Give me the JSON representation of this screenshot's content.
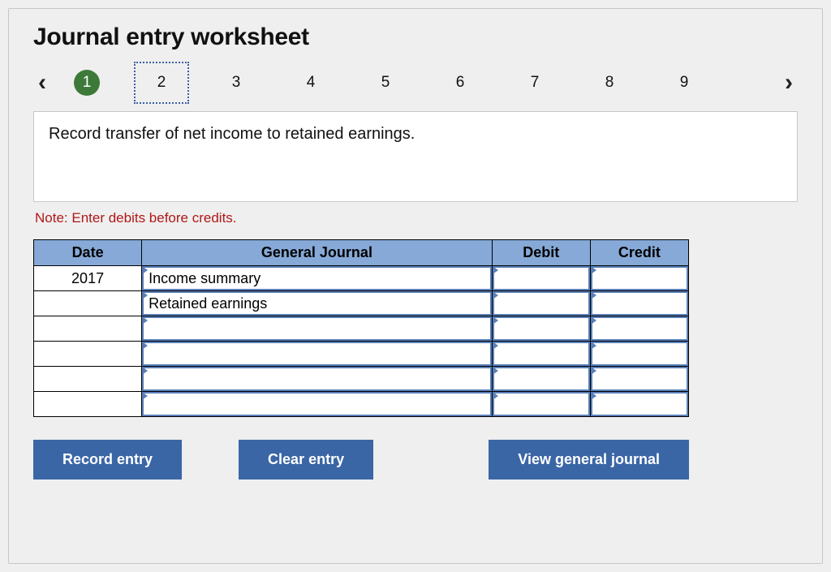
{
  "title": "Journal entry worksheet",
  "pager": {
    "prev_glyph": "‹",
    "next_glyph": "›",
    "tabs": [
      "1",
      "2",
      "3",
      "4",
      "5",
      "6",
      "7",
      "8",
      "9"
    ],
    "completed_index": 0,
    "current_index": 1
  },
  "prompt": "Record transfer of net income to retained earnings.",
  "note": "Note: Enter debits before credits.",
  "table": {
    "headers": {
      "date": "Date",
      "gj": "General Journal",
      "debit": "Debit",
      "credit": "Credit"
    },
    "rows": [
      {
        "date": "2017",
        "gj": "Income summary",
        "debit": "",
        "credit": ""
      },
      {
        "date": "",
        "gj": "Retained earnings",
        "debit": "",
        "credit": ""
      },
      {
        "date": "",
        "gj": "",
        "debit": "",
        "credit": ""
      },
      {
        "date": "",
        "gj": "",
        "debit": "",
        "credit": ""
      },
      {
        "date": "",
        "gj": "",
        "debit": "",
        "credit": ""
      },
      {
        "date": "",
        "gj": "",
        "debit": "",
        "credit": ""
      }
    ]
  },
  "buttons": {
    "record": "Record entry",
    "clear": "Clear entry",
    "view": "View general journal"
  }
}
